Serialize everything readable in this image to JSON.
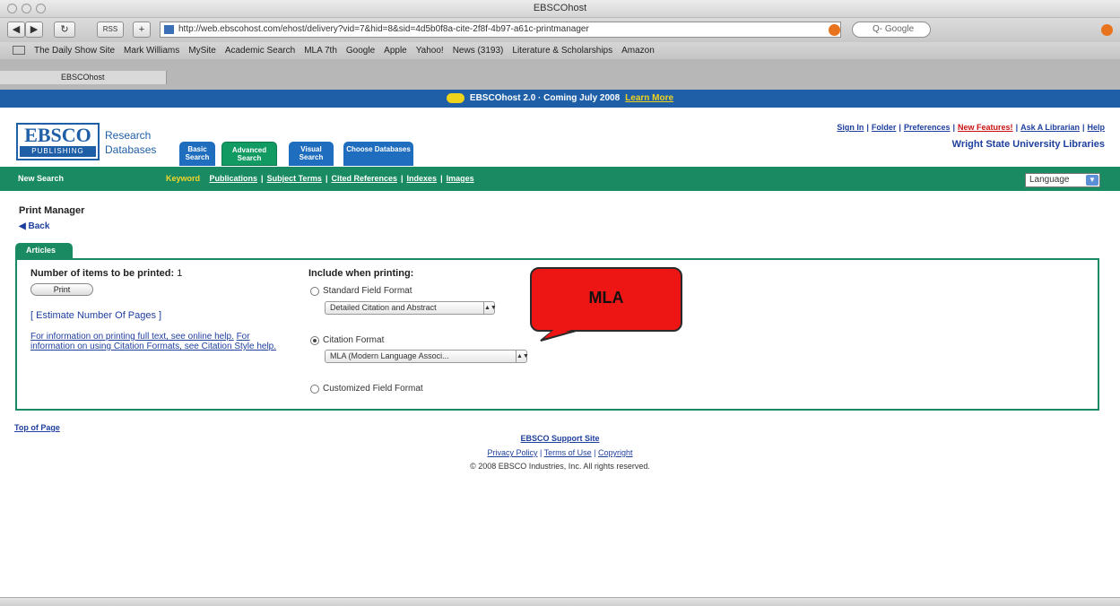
{
  "window": {
    "title": "EBSCOhost"
  },
  "toolbar": {
    "back": "◀",
    "forward": "▶",
    "reload": "↻",
    "rss": "RSS",
    "add": "+",
    "url": "http://web.ebscohost.com/ehost/delivery?vid=7&hid=8&sid=4d5b0f8a-cite-2f8f-4b97-a61c-printmanager",
    "search_placeholder": "Q- Google"
  },
  "bookmarks": [
    "The Daily Show Site",
    "Mark Williams",
    "MySite",
    "Academic Search",
    "MLA 7th",
    "Google",
    "Apple",
    "Yahoo!",
    "News (3193)",
    "Literature & Scholarships",
    "Amazon"
  ],
  "browser_tab": {
    "label": "EBSCOhost"
  },
  "promo": {
    "text": "EBSCOhost 2.0 · Coming July 2008",
    "link": "Learn More"
  },
  "logo": {
    "name": "EBSCO",
    "sub": "PUBLISHING"
  },
  "header": {
    "research_databases": "Research Databases",
    "tabs": [
      {
        "label": "Basic Search"
      },
      {
        "label": "Advanced Search"
      },
      {
        "label": "Visual Search"
      },
      {
        "label": "Choose Databases"
      }
    ],
    "links": [
      "Sign In",
      "Folder",
      "Preferences",
      "New Features!",
      "Ask A Librarian",
      "Help"
    ],
    "institution": "Wright State University Libraries"
  },
  "nav": {
    "new_search": "New Search",
    "keyword": "Keyword",
    "links": [
      "Publications",
      "Subject Terms",
      "Cited References",
      "Indexes",
      "Images"
    ],
    "language": "Language"
  },
  "print_manager": {
    "title": "Print Manager",
    "back": "◀ Back",
    "folder_tab": "Articles",
    "items_label": "Number of items to be printed:",
    "items_count": "1",
    "print_button": "Print",
    "estimate": "[ Estimate Number Of Pages ]",
    "help_text": "For information on printing full text, see online help.",
    "help_text2": "For information on using Citation Formats, see Citation Style help.",
    "include_label": "Include when printing:",
    "standard_label": "Standard Field Format",
    "standard_select": "Detailed Citation and Abstract",
    "citation_label": "Citation Format",
    "citation_select": "MLA (Modern Language Associ...",
    "customized_label": "Customized Field Format"
  },
  "callout": {
    "text": "MLA"
  },
  "footer": {
    "top_of_page": "Top of Page",
    "support_site": "EBSCO Support Site",
    "privacy": "Privacy Policy",
    "terms": "Terms of Use",
    "copyright_link": "Copyright",
    "copyright": "© 2008 EBSCO Industries, Inc. All rights reserved."
  }
}
